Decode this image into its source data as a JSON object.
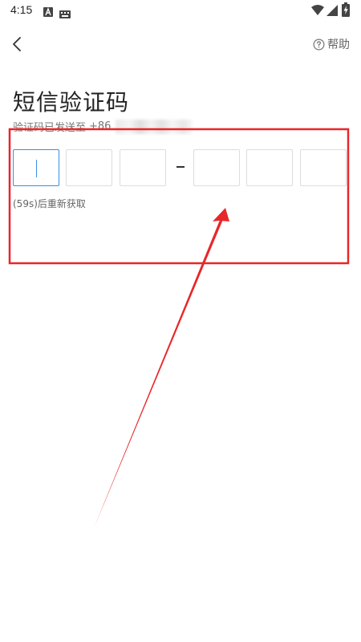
{
  "status_bar": {
    "time": "4:15",
    "icons": [
      "font-a-icon",
      "keyboard-icon",
      "wifi-icon",
      "signal-icon",
      "battery-charging-icon"
    ]
  },
  "header": {
    "back_icon": "chevron-left-icon",
    "help_icon": "question-circle-icon",
    "help_label": "帮助"
  },
  "main": {
    "title": "短信验证码",
    "subtitle_prefix": "验证码已发送至",
    "phone_prefix": "+86",
    "code_boxes": [
      "",
      "",
      "",
      "",
      "",
      ""
    ],
    "separator": "–",
    "resend_label": "(59s)后重新获取"
  },
  "colors": {
    "accent": "#3a8ee6",
    "annotation": "#e8262a",
    "text_primary": "#222222",
    "text_secondary": "#777777",
    "box_border": "#dcdcdc"
  }
}
